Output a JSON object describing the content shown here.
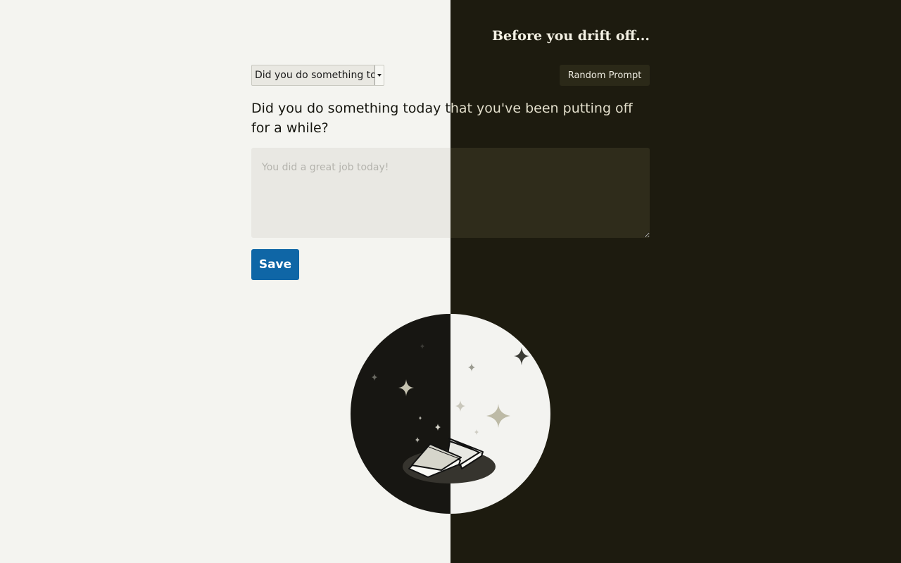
{
  "header": {
    "title": "Before you drift off..."
  },
  "prompt_select": {
    "selected": "Did you do something today that you've been putting off for a while?"
  },
  "random_button": {
    "label": "Random Prompt"
  },
  "prompt": {
    "text": "Did you do something today that you've been putting off for a while?"
  },
  "journal": {
    "placeholder": "You did a great job today!",
    "value": ""
  },
  "save_button": {
    "label": "Save"
  },
  "illustration": {
    "icon": "night-book-illustration"
  },
  "colors": {
    "light_bg": "#f4f4f0",
    "dark_bg": "#1d1b0f",
    "save_blue": "#0f66a6",
    "random_button_bg": "#2b2918"
  }
}
